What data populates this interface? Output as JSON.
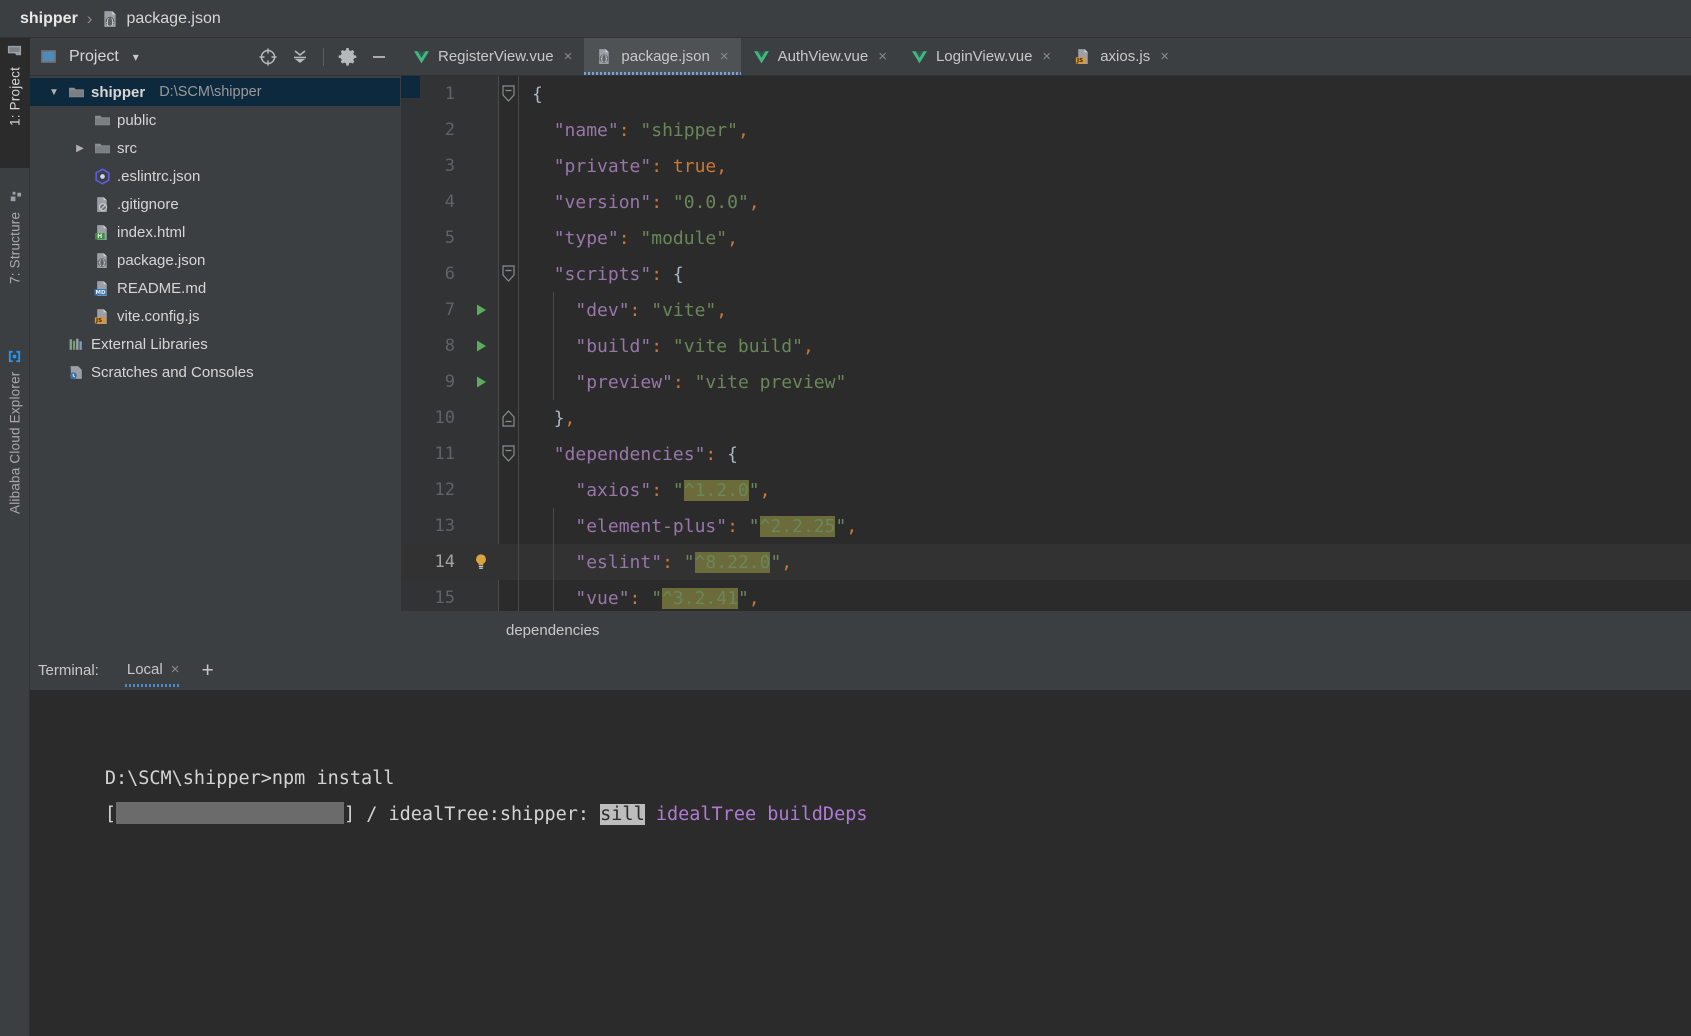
{
  "navbar": {
    "project_name": "shipper",
    "separator": "›",
    "file_name": "package.json",
    "file_icon": "json-file-icon"
  },
  "toolstrip": {
    "tabs": [
      {
        "label": "1: Project",
        "icon": "project-folder-icon",
        "active": true
      },
      {
        "label": "7: Structure",
        "icon": "structure-icon",
        "active": false
      },
      {
        "label": "Alibaba Cloud Explorer",
        "icon": "cloud-explorer-icon",
        "active": false
      }
    ]
  },
  "project_panel": {
    "title": "Project",
    "dropdown_caret": "▾",
    "buttons": [
      {
        "name": "select-opened-file-button",
        "icon": "crosshair-icon"
      },
      {
        "name": "collapse-all-button",
        "icon": "collapse-all-icon"
      },
      {
        "name": "settings-button",
        "icon": "gear-icon"
      },
      {
        "name": "hide-button",
        "icon": "minus-icon"
      }
    ],
    "tree": [
      {
        "label": "shipper",
        "sub": "D:\\SCM\\shipper",
        "icon": "folder-icon",
        "arrow": "▼",
        "indent": 0,
        "bold": true,
        "selected": true
      },
      {
        "label": "public",
        "sub": "",
        "icon": "folder-icon",
        "arrow": "",
        "indent": 1,
        "bold": false,
        "selected": false
      },
      {
        "label": "src",
        "sub": "",
        "icon": "folder-icon",
        "arrow": "▶",
        "indent": 1,
        "bold": false,
        "selected": false
      },
      {
        "label": ".eslintrc.json",
        "sub": "",
        "icon": "eslint-icon",
        "arrow": "",
        "indent": 1,
        "bold": false,
        "selected": false
      },
      {
        "label": ".gitignore",
        "sub": "",
        "icon": "gitignore-icon",
        "arrow": "",
        "indent": 1,
        "bold": false,
        "selected": false
      },
      {
        "label": "index.html",
        "sub": "",
        "icon": "html-file-icon",
        "arrow": "",
        "indent": 1,
        "bold": false,
        "selected": false
      },
      {
        "label": "package.json",
        "sub": "",
        "icon": "json-file-icon",
        "arrow": "",
        "indent": 1,
        "bold": false,
        "selected": false
      },
      {
        "label": "README.md",
        "sub": "",
        "icon": "markdown-file-icon",
        "arrow": "",
        "indent": 1,
        "bold": false,
        "selected": false
      },
      {
        "label": "vite.config.js",
        "sub": "",
        "icon": "js-file-icon",
        "arrow": "",
        "indent": 1,
        "bold": false,
        "selected": false
      },
      {
        "label": "External Libraries",
        "sub": "",
        "icon": "libraries-icon",
        "arrow": "",
        "indent": 0,
        "bold": false,
        "selected": false
      },
      {
        "label": "Scratches and Consoles",
        "sub": "",
        "icon": "scratches-icon",
        "arrow": "",
        "indent": 0,
        "bold": false,
        "selected": false
      }
    ]
  },
  "editor": {
    "tabs": [
      {
        "label": "RegisterView.vue",
        "icon": "vue-file-icon",
        "active": false,
        "close": "×"
      },
      {
        "label": "package.json",
        "icon": "json-file-icon",
        "active": true,
        "close": "×"
      },
      {
        "label": "AuthView.vue",
        "icon": "vue-file-icon",
        "active": false,
        "close": "×"
      },
      {
        "label": "LoginView.vue",
        "icon": "vue-file-icon",
        "active": false,
        "close": "×"
      },
      {
        "label": "axios.js",
        "icon": "js-file-icon",
        "active": false,
        "close": "×"
      }
    ],
    "breadcrumb": "dependencies",
    "lines": [
      {
        "n": "1",
        "indent": 0,
        "fold": "collapse",
        "run": false,
        "bulb": false,
        "current": false,
        "tokens": [
          {
            "t": "{",
            "c": "k-brace"
          }
        ]
      },
      {
        "n": "2",
        "indent": 1,
        "fold": "",
        "run": false,
        "bulb": false,
        "current": false,
        "tokens": [
          {
            "t": "\"name\"",
            "c": "k-key"
          },
          {
            "t": ":",
            "c": "k-punc"
          },
          {
            "t": " ",
            "c": ""
          },
          {
            "t": "\"shipper\"",
            "c": "k-str"
          },
          {
            "t": ",",
            "c": "k-punc"
          }
        ]
      },
      {
        "n": "3",
        "indent": 1,
        "fold": "",
        "run": false,
        "bulb": false,
        "current": false,
        "tokens": [
          {
            "t": "\"private\"",
            "c": "k-key"
          },
          {
            "t": ":",
            "c": "k-punc"
          },
          {
            "t": " ",
            "c": ""
          },
          {
            "t": "true",
            "c": "k-bool"
          },
          {
            "t": ",",
            "c": "k-punc"
          }
        ]
      },
      {
        "n": "4",
        "indent": 1,
        "fold": "",
        "run": false,
        "bulb": false,
        "current": false,
        "tokens": [
          {
            "t": "\"version\"",
            "c": "k-key"
          },
          {
            "t": ":",
            "c": "k-punc"
          },
          {
            "t": " ",
            "c": ""
          },
          {
            "t": "\"0.0.0\"",
            "c": "k-str"
          },
          {
            "t": ",",
            "c": "k-punc"
          }
        ]
      },
      {
        "n": "5",
        "indent": 1,
        "fold": "",
        "run": false,
        "bulb": false,
        "current": false,
        "tokens": [
          {
            "t": "\"type\"",
            "c": "k-key"
          },
          {
            "t": ":",
            "c": "k-punc"
          },
          {
            "t": " ",
            "c": ""
          },
          {
            "t": "\"module\"",
            "c": "k-str"
          },
          {
            "t": ",",
            "c": "k-punc"
          }
        ]
      },
      {
        "n": "6",
        "indent": 1,
        "fold": "collapse",
        "run": false,
        "bulb": false,
        "current": false,
        "tokens": [
          {
            "t": "\"scripts\"",
            "c": "k-key"
          },
          {
            "t": ":",
            "c": "k-punc"
          },
          {
            "t": " ",
            "c": ""
          },
          {
            "t": "{",
            "c": "k-brace"
          }
        ]
      },
      {
        "n": "7",
        "indent": 2,
        "fold": "",
        "run": true,
        "bulb": false,
        "current": false,
        "tokens": [
          {
            "t": "\"dev\"",
            "c": "k-key"
          },
          {
            "t": ":",
            "c": "k-punc"
          },
          {
            "t": " ",
            "c": ""
          },
          {
            "t": "\"vite\"",
            "c": "k-str"
          },
          {
            "t": ",",
            "c": "k-punc"
          }
        ]
      },
      {
        "n": "8",
        "indent": 2,
        "fold": "",
        "run": true,
        "bulb": false,
        "current": false,
        "tokens": [
          {
            "t": "\"build\"",
            "c": "k-key"
          },
          {
            "t": ":",
            "c": "k-punc"
          },
          {
            "t": " ",
            "c": ""
          },
          {
            "t": "\"vite build\"",
            "c": "k-str"
          },
          {
            "t": ",",
            "c": "k-punc"
          }
        ]
      },
      {
        "n": "9",
        "indent": 2,
        "fold": "",
        "run": true,
        "bulb": false,
        "current": false,
        "tokens": [
          {
            "t": "\"preview\"",
            "c": "k-key"
          },
          {
            "t": ":",
            "c": "k-punc"
          },
          {
            "t": " ",
            "c": ""
          },
          {
            "t": "\"vite preview\"",
            "c": "k-str"
          }
        ]
      },
      {
        "n": "10",
        "indent": 1,
        "fold": "expand",
        "run": false,
        "bulb": false,
        "current": false,
        "tokens": [
          {
            "t": "}",
            "c": "k-brace"
          },
          {
            "t": ",",
            "c": "k-punc"
          }
        ]
      },
      {
        "n": "11",
        "indent": 1,
        "fold": "collapse",
        "run": false,
        "bulb": false,
        "current": false,
        "tokens": [
          {
            "t": "\"dependencies\"",
            "c": "k-key"
          },
          {
            "t": ":",
            "c": "k-punc"
          },
          {
            "t": " ",
            "c": ""
          },
          {
            "t": "{",
            "c": "k-brace"
          }
        ]
      },
      {
        "n": "12",
        "indent": 2,
        "fold": "",
        "run": false,
        "bulb": false,
        "current": false,
        "tokens": [
          {
            "t": "\"axios\"",
            "c": "k-key"
          },
          {
            "t": ":",
            "c": "k-punc"
          },
          {
            "t": " ",
            "c": ""
          },
          {
            "t": "\"",
            "c": "k-str"
          },
          {
            "t": "^1.2.0",
            "c": "k-str hl"
          },
          {
            "t": "\"",
            "c": "k-str"
          },
          {
            "t": ",",
            "c": "k-punc"
          }
        ]
      },
      {
        "n": "13",
        "indent": 2,
        "fold": "",
        "run": false,
        "bulb": false,
        "current": false,
        "tokens": [
          {
            "t": "\"element-plus\"",
            "c": "k-key"
          },
          {
            "t": ":",
            "c": "k-punc"
          },
          {
            "t": " ",
            "c": ""
          },
          {
            "t": "\"",
            "c": "k-str"
          },
          {
            "t": "^2.2.25",
            "c": "k-str hl"
          },
          {
            "t": "\"",
            "c": "k-str"
          },
          {
            "t": ",",
            "c": "k-punc"
          }
        ]
      },
      {
        "n": "14",
        "indent": 2,
        "fold": "",
        "run": false,
        "bulb": true,
        "current": true,
        "tokens": [
          {
            "t": "\"eslint\"",
            "c": "k-key"
          },
          {
            "t": ":",
            "c": "k-punc"
          },
          {
            "t": " ",
            "c": ""
          },
          {
            "t": "\"",
            "c": "k-str"
          },
          {
            "t": "^8.22.0",
            "c": "k-str hl"
          },
          {
            "t": "\"",
            "c": "k-str"
          },
          {
            "t": ",",
            "c": "k-punc"
          }
        ]
      },
      {
        "n": "15",
        "indent": 2,
        "fold": "",
        "run": false,
        "bulb": false,
        "current": false,
        "tokens": [
          {
            "t": "\"vue\"",
            "c": "k-key"
          },
          {
            "t": ":",
            "c": "k-punc"
          },
          {
            "t": " ",
            "c": ""
          },
          {
            "t": "\"",
            "c": "k-str"
          },
          {
            "t": "^3.2.41",
            "c": "k-str hl"
          },
          {
            "t": "\"",
            "c": "k-str"
          },
          {
            "t": ",",
            "c": "k-punc"
          }
        ]
      }
    ]
  },
  "terminal": {
    "label": "Terminal:",
    "tab_label": "Local",
    "tab_close": "×",
    "add_button": "+",
    "lines": [
      {
        "type": "plain",
        "text": "D:\\SCM\\shipper>npm install"
      },
      {
        "type": "progress",
        "prefix": "[",
        "suffix": "] / idealTree:shipper: ",
        "highlight": "sill",
        "tail": " idealTree buildDeps"
      }
    ]
  },
  "colors": {
    "panel_bg": "#3c3f41",
    "editor_bg": "#2b2b2b",
    "gutter_bg": "#313335",
    "selection_blue": "#0d293e",
    "accent_blue": "#4a88c7",
    "string_green": "#6a8759",
    "key_purple": "#9876aa",
    "punct_orange": "#cc7832",
    "highlight_olive": "#6b6b3c",
    "run_green": "#5aad5a",
    "bulb_orange": "#d9a441"
  }
}
